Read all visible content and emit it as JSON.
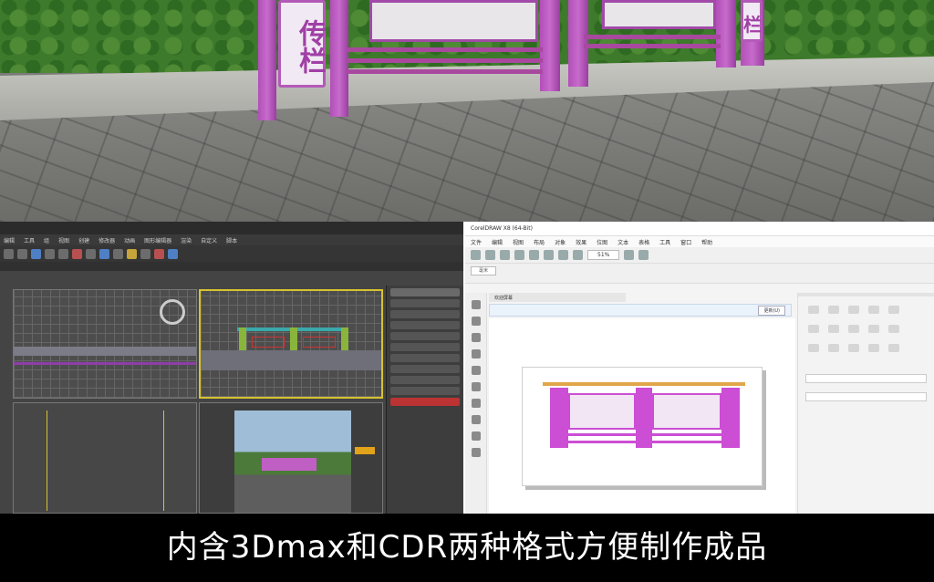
{
  "render": {
    "sign_left": "传栏",
    "sign_right": "栏"
  },
  "max": {
    "menu": [
      "编辑",
      "工具",
      "组",
      "视图",
      "创建",
      "修改器",
      "动画",
      "图形编辑器",
      "渲染",
      "自定义",
      "脚本"
    ]
  },
  "cdr": {
    "title": "CorelDRAW X8 (64-Bit)",
    "menu": [
      "文件",
      "编辑",
      "视图",
      "布局",
      "对象",
      "效果",
      "位图",
      "文本",
      "表格",
      "工具",
      "窗口",
      "帮助"
    ],
    "zoom": "51%",
    "units": "毫米",
    "tab": "欢迎屏幕",
    "info_btn": "更新(U)"
  },
  "caption": "内含3Dmax和CDR两种格式方便制作成品",
  "colors": {
    "accent": "#b24fb8",
    "caption_bg": "#000000"
  }
}
